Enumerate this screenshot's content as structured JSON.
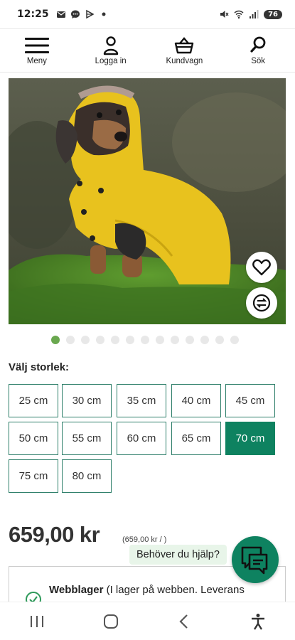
{
  "status_bar": {
    "time": "12:25",
    "left_icons": [
      "mail-icon",
      "chat-icon",
      "play-icon",
      "dot-icon"
    ],
    "right_icons": [
      "mute-icon",
      "wifi-icon",
      "signal-icon"
    ],
    "battery": "76"
  },
  "header": {
    "items": [
      {
        "label": "Meny",
        "icon": "menu-icon"
      },
      {
        "label": "Logga in",
        "icon": "user-icon"
      },
      {
        "label": "Kundvagn",
        "icon": "basket-icon"
      },
      {
        "label": "Sök",
        "icon": "search-icon"
      }
    ]
  },
  "product": {
    "image_alt": "Dachshund in yellow raincoat",
    "carousel_total": 13,
    "carousel_active": 1
  },
  "size": {
    "label": "Välj storlek:",
    "options": [
      "25 cm",
      "30 cm",
      "35 cm",
      "40 cm",
      "45 cm",
      "50 cm",
      "55 cm",
      "60 cm",
      "65 cm",
      "70 cm",
      "75 cm",
      "80 cm"
    ],
    "selected": "70 cm"
  },
  "price": {
    "value": "659,00 kr",
    "unit_price": "(659,00 kr / )"
  },
  "help": {
    "bubble": "Behöver du hjälp?"
  },
  "stock": {
    "title": "Webblager",
    "text": " (I lager på webben. Leverans"
  },
  "colors": {
    "accent": "#0e8260",
    "active_dot": "#6aa84f",
    "coat": "#e8c21e"
  }
}
